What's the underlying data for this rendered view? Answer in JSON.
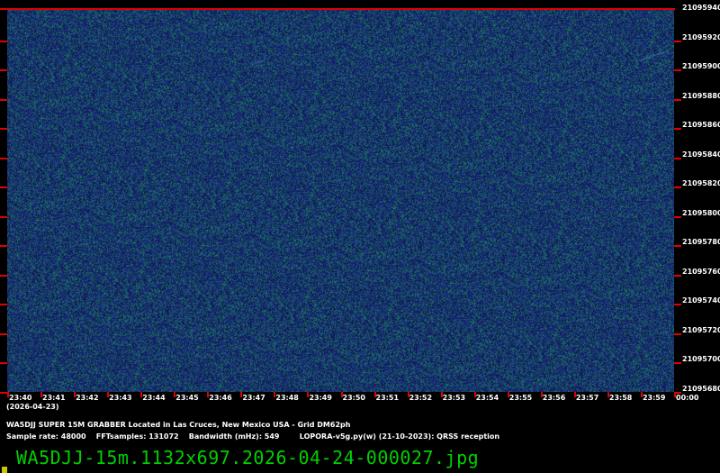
{
  "spectrogram": {
    "background_color": "#1a2a78",
    "noise_color": "#1f7a4a",
    "marker_color": "#e00000"
  },
  "frequency_axis": {
    "labels": [
      "21095940",
      "21095920",
      "21095900",
      "21095880",
      "21095860",
      "21095840",
      "21095820",
      "21095800",
      "21095780",
      "21095760",
      "21095740",
      "21095720",
      "21095700",
      "21095680"
    ]
  },
  "time_axis": {
    "labels": [
      "23:40",
      "23:41",
      "23:42",
      "23:43",
      "23:44",
      "23:45",
      "23:46",
      "23:47",
      "23:48",
      "23:49",
      "23:50",
      "23:51",
      "23:52",
      "23:53",
      "23:54",
      "23:55",
      "23:56",
      "23:57",
      "23:58",
      "23:59",
      "00:00"
    ],
    "date": "(2026-04-23)"
  },
  "info": {
    "station": "WA5DJJ SUPER 15M GRABBER Located in Las Cruces, New Mexico USA - Grid DM62ph",
    "sample_rate": "Sample rate: 48000",
    "fft_samples": "FFTsamples: 131072",
    "bandwidth": "Bandwidth (mHz): 549",
    "software": "LOPORA-v5g.py(w) (21-10-2023): QRSS reception"
  },
  "filename": "WA5DJJ-15m.1132x697.2026-04-24-000027.jpg"
}
